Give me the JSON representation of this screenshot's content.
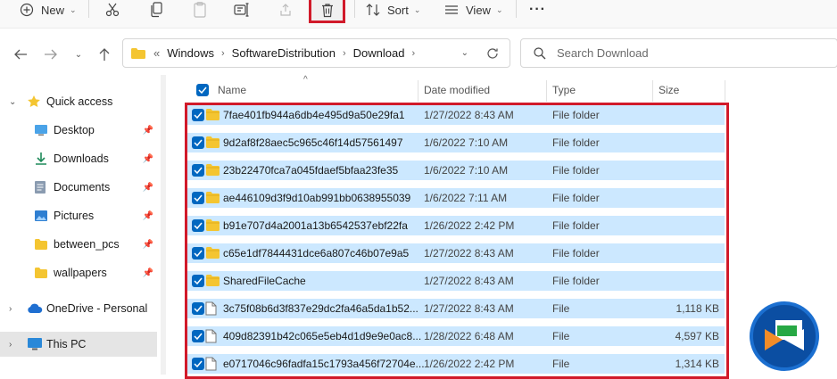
{
  "toolbar": {
    "new_label": "New",
    "sort_label": "Sort",
    "view_label": "View",
    "more_label": "···"
  },
  "address": {
    "overflow": "«",
    "crumbs": [
      "Windows",
      "SoftwareDistribution",
      "Download"
    ]
  },
  "search": {
    "placeholder": "Search Download"
  },
  "sidebar": {
    "items": [
      {
        "label": "Quick access",
        "icon": "star-icon"
      },
      {
        "label": "Desktop",
        "icon": "desktop-icon"
      },
      {
        "label": "Downloads",
        "icon": "download-icon"
      },
      {
        "label": "Documents",
        "icon": "documents-icon"
      },
      {
        "label": "Pictures",
        "icon": "pictures-icon"
      },
      {
        "label": "between_pcs",
        "icon": "folder-icon"
      },
      {
        "label": "wallpapers",
        "icon": "folder-icon"
      },
      {
        "label": "OneDrive - Personal",
        "icon": "cloud-icon"
      },
      {
        "label": "This PC",
        "icon": "computer-icon"
      }
    ]
  },
  "columns": {
    "name": "Name",
    "date": "Date modified",
    "type": "Type",
    "size": "Size"
  },
  "files": [
    {
      "name": "7fae401fb944a6db4e495d9a50e29fa1",
      "date": "1/27/2022 8:43 AM",
      "type": "File folder",
      "size": "",
      "kind": "folder"
    },
    {
      "name": "9d2af8f28aec5c965c46f14d57561497",
      "date": "1/6/2022 7:10 AM",
      "type": "File folder",
      "size": "",
      "kind": "folder"
    },
    {
      "name": "23b22470fca7a045fdaef5bfaa23fe35",
      "date": "1/6/2022 7:10 AM",
      "type": "File folder",
      "size": "",
      "kind": "folder"
    },
    {
      "name": "ae446109d3f9d10ab991bb0638955039",
      "date": "1/6/2022 7:11 AM",
      "type": "File folder",
      "size": "",
      "kind": "folder"
    },
    {
      "name": "b91e707d4a2001a13b6542537ebf22fa",
      "date": "1/26/2022 2:42 PM",
      "type": "File folder",
      "size": "",
      "kind": "folder"
    },
    {
      "name": "c65e1df7844431dce6a807c46b07e9a5",
      "date": "1/27/2022 8:43 AM",
      "type": "File folder",
      "size": "",
      "kind": "folder"
    },
    {
      "name": "SharedFileCache",
      "date": "1/27/2022 8:43 AM",
      "type": "File folder",
      "size": "",
      "kind": "folder"
    },
    {
      "name": "3c75f08b6d3f837e29dc2fa46a5da1b52...",
      "date": "1/27/2022 8:43 AM",
      "type": "File",
      "size": "1,118 KB",
      "kind": "file"
    },
    {
      "name": "409d82391b42c065e5eb4d1d9e9e0ac8...",
      "date": "1/28/2022 6:48 AM",
      "type": "File",
      "size": "4,597 KB",
      "kind": "file"
    },
    {
      "name": "e0717046c96fadfa15c1793a456f72704e...",
      "date": "1/26/2022 2:42 PM",
      "type": "File",
      "size": "1,314 KB",
      "kind": "file"
    }
  ],
  "colors": {
    "selection": "#cce8ff",
    "checkbox": "#0067c0",
    "highlight": "#d11a2a",
    "folder": "#f4c531"
  }
}
